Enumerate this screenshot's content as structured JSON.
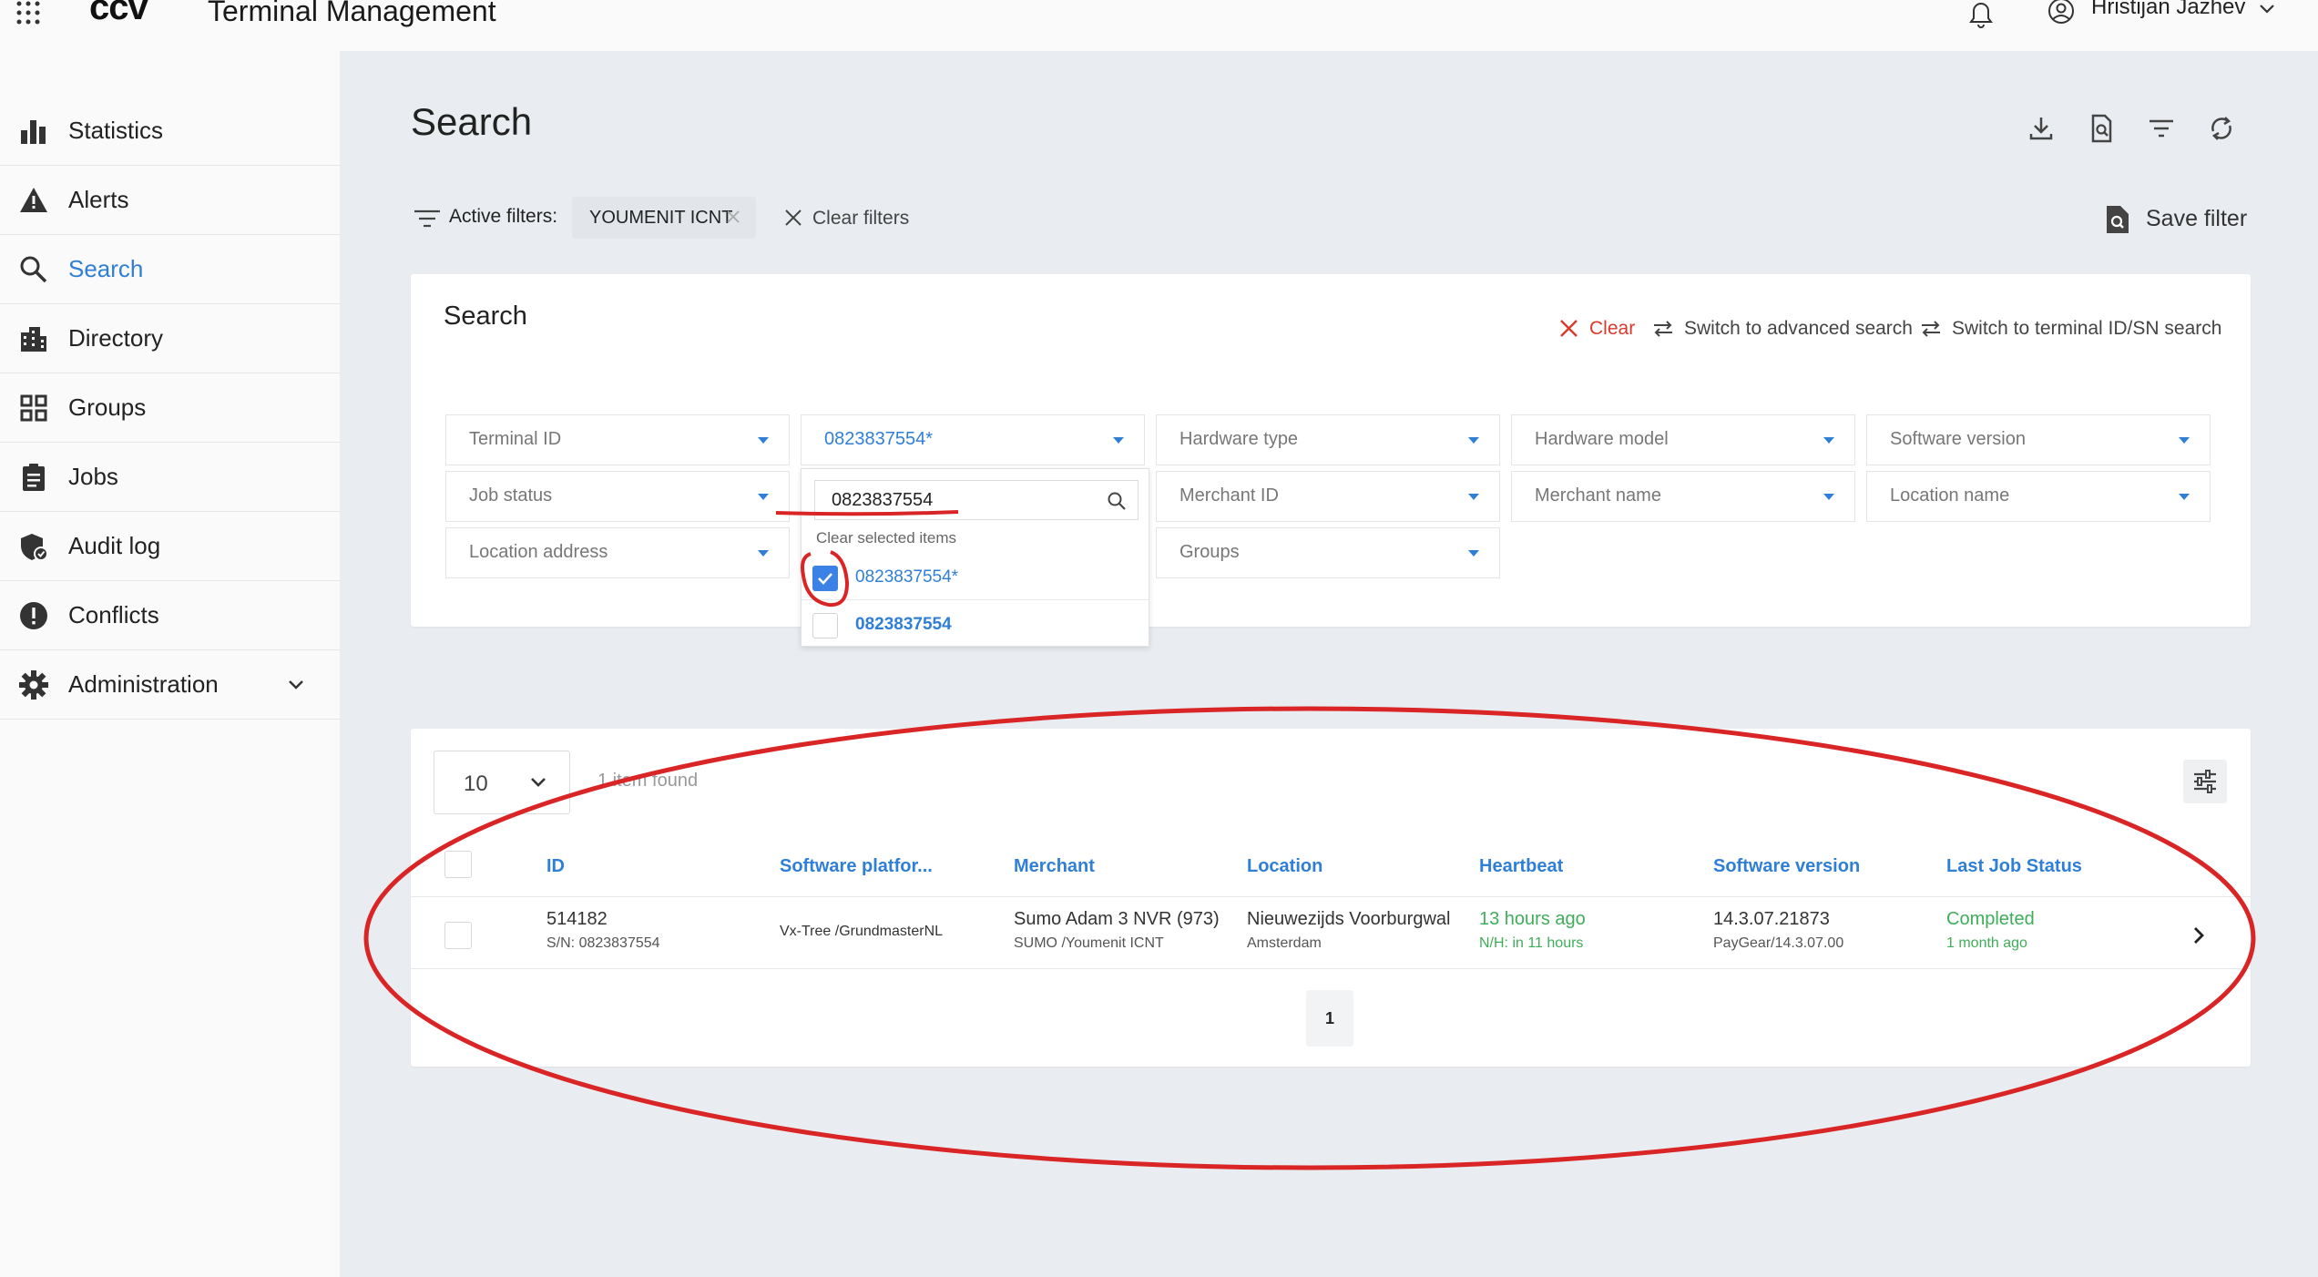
{
  "header": {
    "logo": "ccv",
    "app_title": "Terminal Management",
    "user_name": "Hristijan Jazhev"
  },
  "sidebar": {
    "items": [
      {
        "label": "Statistics",
        "icon": "bar-chart-icon"
      },
      {
        "label": "Alerts",
        "icon": "warning-icon"
      },
      {
        "label": "Search",
        "icon": "search-icon",
        "active": true
      },
      {
        "label": "Directory",
        "icon": "building-icon"
      },
      {
        "label": "Groups",
        "icon": "grid-icon"
      },
      {
        "label": "Jobs",
        "icon": "clipboard-icon"
      },
      {
        "label": "Audit log",
        "icon": "shield-icon"
      },
      {
        "label": "Conflicts",
        "icon": "exclamation-icon"
      },
      {
        "label": "Administration",
        "icon": "gear-icon",
        "expandable": true
      }
    ]
  },
  "page": {
    "title": "Search",
    "actions": [
      "download-icon",
      "document-search-icon",
      "filter-icon",
      "refresh-icon"
    ]
  },
  "filters": {
    "active_label": "Active filters:",
    "chip": "YOUMENIT ICNT",
    "clear_label": "Clear filters",
    "save_label": "Save filter"
  },
  "search_card": {
    "title": "Search",
    "clear": "Clear",
    "advanced": "Switch to advanced search",
    "terminal_sn": "Switch to terminal ID/SN search",
    "fields": {
      "terminal_id": "Terminal ID",
      "serial": "0823837554*",
      "hardware_type": "Hardware type",
      "hardware_model": "Hardware model",
      "software_version": "Software version",
      "job_status": "Job status",
      "merchant_id": "Merchant ID",
      "merchant_name": "Merchant name",
      "location_name": "Location name",
      "location_address": "Location address",
      "groups": "Groups"
    },
    "popup": {
      "search_value": "0823837554",
      "clear_selected": "Clear selected items",
      "options": [
        {
          "label": "0823837554*",
          "checked": true
        },
        {
          "label": "0823837554",
          "checked": false
        }
      ]
    }
  },
  "results": {
    "page_size": "10",
    "items_found": "1 item found",
    "columns": [
      "ID",
      "Software platfor...",
      "Merchant",
      "Location",
      "Heartbeat",
      "Software version",
      "Last Job Status"
    ],
    "rows": [
      {
        "id": "514182",
        "sn": "S/N: 0823837554",
        "platform": "Vx-Tree /GrundmasterNL",
        "merchant": "Sumo Adam 3 NVR (973)",
        "merchant_sub": "SUMO /Youmenit ICNT",
        "location": "Nieuwezijds Voorburgwal",
        "location_sub": "Amsterdam",
        "heartbeat": "13 hours ago",
        "heartbeat_sub": "N/H: in 11 hours",
        "software_version": "14.3.07.21873",
        "software_sub": "PayGear/14.3.07.00",
        "job_status": "Completed",
        "job_status_sub": "1 month ago"
      }
    ],
    "page": "1"
  },
  "colors": {
    "accent": "#2f7fd6",
    "success": "#3fae5a",
    "danger": "#d83a2d",
    "annotation": "#d92525"
  }
}
